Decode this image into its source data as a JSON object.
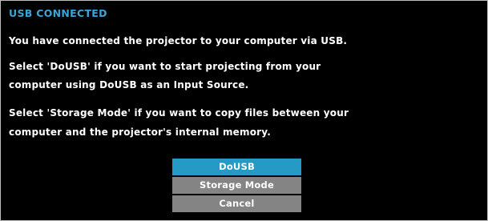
{
  "dialog": {
    "title": "USB CONNECTED",
    "lines": [
      "You have connected the projector to your computer via USB.",
      "Select 'DoUSB' if you want to start projecting from your",
      "computer using DoUSB as an Input Source.",
      "Select 'Storage Mode' if you want to copy files between your",
      "computer and the projector's internal memory."
    ]
  },
  "options": [
    {
      "label": "DoUSB",
      "selected": true
    },
    {
      "label": "Storage Mode",
      "selected": false
    },
    {
      "label": "Cancel",
      "selected": false
    }
  ],
  "colors": {
    "background": "#000000",
    "title": "#3aa6d8",
    "text": "#ffffff",
    "option_selected": "#249ac4",
    "option_default": "#848484"
  }
}
